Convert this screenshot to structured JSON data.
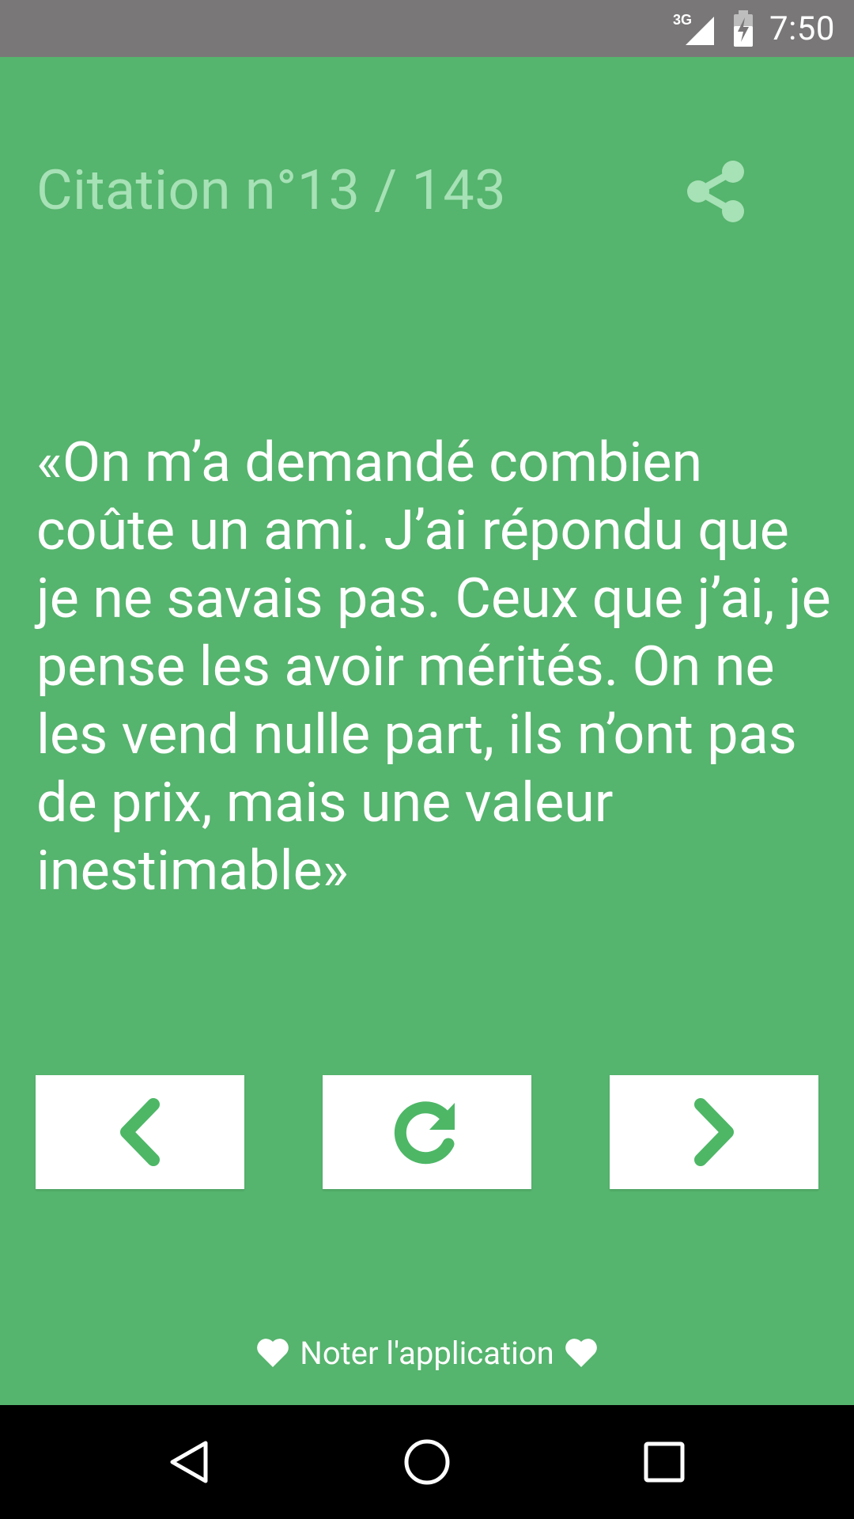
{
  "status_bar": {
    "network": "3G",
    "time": "7:50"
  },
  "header": {
    "title": "Citation n°13 / 143"
  },
  "quote": {
    "text": "«On m’a demandé combien coûte un ami. J’ai répondu que je ne savais pas. Ceux que j’ai, je pense les avoir mérités. On ne les vend nulle part, ils n’ont pas de prix, mais une valeur inestimable»"
  },
  "buttons": {
    "previous": {
      "icon": "chevron-left-icon"
    },
    "refresh": {
      "icon": "refresh-icon"
    },
    "next": {
      "icon": "chevron-right-icon"
    }
  },
  "rate": {
    "label": "Noter l'application"
  },
  "colors": {
    "background": "#55b46d",
    "header_text": "#a7e1b6",
    "accent": "#4db766",
    "status_bar": "#797778",
    "nav_bar": "#000000"
  }
}
